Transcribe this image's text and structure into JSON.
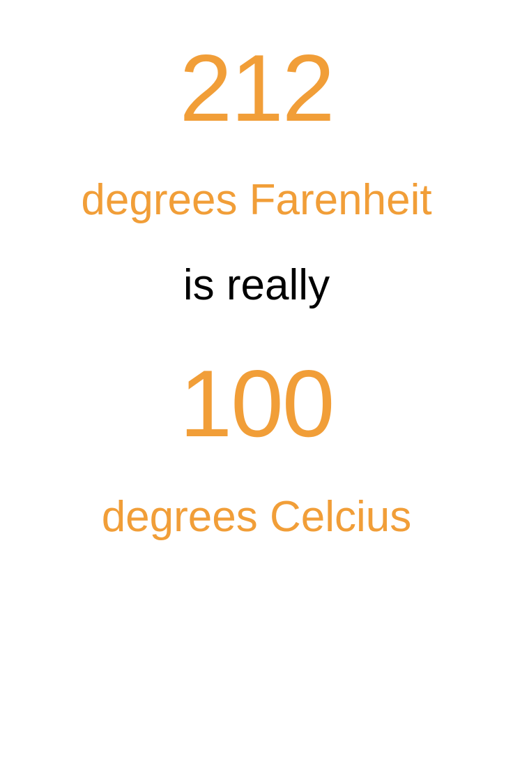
{
  "converter": {
    "fahrenheit_value": "212",
    "fahrenheit_label": "degrees Farenheit",
    "connector": "is really",
    "celsius_value": "100",
    "celsius_label": "degrees Celcius"
  },
  "colors": {
    "accent": "#F19E38",
    "text": "#000000",
    "background": "#FFFFFF"
  }
}
